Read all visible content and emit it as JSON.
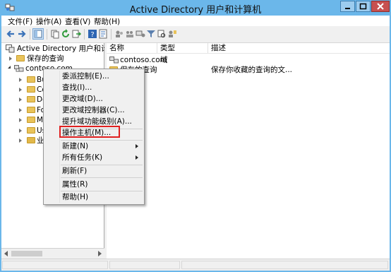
{
  "window": {
    "title": "Active Directory 用户和计算机",
    "accent_color": "#6bb7ea",
    "close_color": "#c75050"
  },
  "menubar": {
    "items": [
      {
        "label": "文件(F)"
      },
      {
        "label": "操作(A)"
      },
      {
        "label": "查看(V)"
      },
      {
        "label": "帮助(H)"
      }
    ]
  },
  "toolbar": {
    "icons": [
      "back-arrow-icon",
      "forward-arrow-icon",
      "folder-up-icon",
      "show-tree-icon",
      "copy-icon",
      "refresh-icon",
      "export-list-icon",
      "help-icon",
      "properties-icon",
      "users-icon",
      "group-icon",
      "computer-icon",
      "filter-icon",
      "find-icon",
      "add-to-group-icon"
    ]
  },
  "tree": {
    "root": "Active Directory 用户和计算机",
    "saved_queries": "保存的查询",
    "domain": "contoso.com",
    "children": [
      "Bu",
      "Co",
      "Do",
      "Fo",
      "Ma",
      "Us",
      "业"
    ]
  },
  "list": {
    "columns": [
      "名称",
      "类型",
      "描述"
    ],
    "rows": [
      {
        "name": "contoso.com",
        "type": "域",
        "description": ""
      },
      {
        "name": "保存的查询",
        "type": "",
        "description": "保存你收藏的查询的文..."
      }
    ]
  },
  "context_menu": {
    "items": [
      {
        "label": "委派控制(E)...",
        "submenu": false
      },
      {
        "label": "查找(I)...",
        "submenu": false
      },
      {
        "label": "更改域(D)...",
        "submenu": false
      },
      {
        "label": "更改域控制器(C)...",
        "submenu": false
      },
      {
        "label": "提升域功能级别(A)...",
        "submenu": false
      },
      {
        "label": "操作主机(M)...",
        "submenu": false,
        "highlighted": true
      },
      {
        "label": "新建(N)",
        "submenu": true
      },
      {
        "label": "所有任务(K)",
        "submenu": true
      },
      {
        "label": "刷新(F)",
        "submenu": false
      },
      {
        "label": "属性(R)",
        "submenu": false
      },
      {
        "label": "帮助(H)",
        "submenu": false
      }
    ],
    "highlight_color": "#e02020"
  }
}
